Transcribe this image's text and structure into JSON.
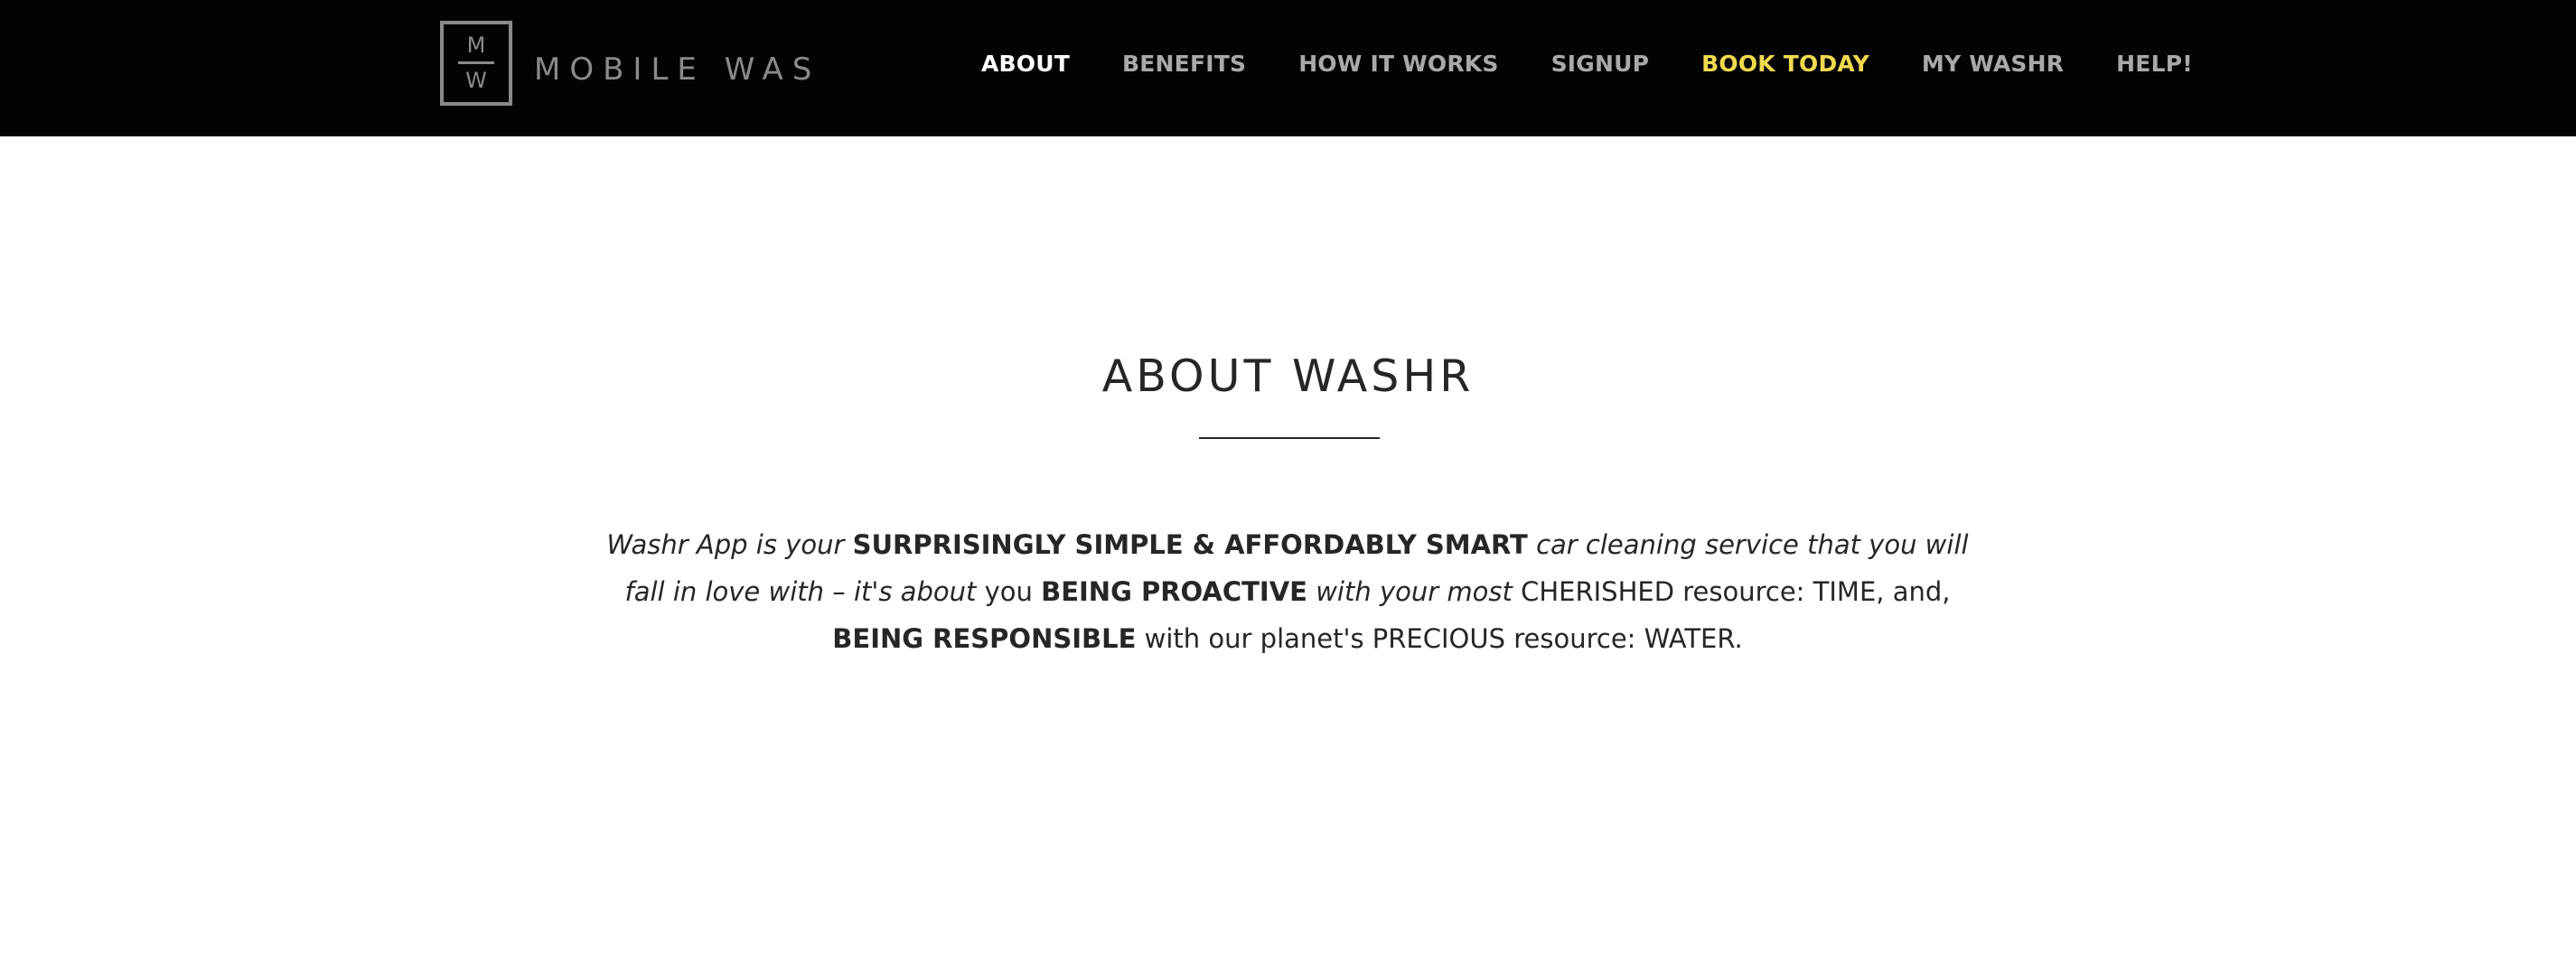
{
  "header": {
    "logo": {
      "monogram_top": "M",
      "monogram_bottom": "W",
      "wordmark": "MOBILE WAS"
    },
    "nav": [
      {
        "label": "ABOUT",
        "state": "active"
      },
      {
        "label": "BENEFITS"
      },
      {
        "label": "HOW IT WORKS"
      },
      {
        "label": "SIGNUP"
      },
      {
        "label": "BOOK TODAY",
        "state": "highlight"
      },
      {
        "label": "MY WASHR"
      },
      {
        "label": "HELP!"
      }
    ]
  },
  "main": {
    "title": "ABOUT WASHR",
    "intro": {
      "p1": "Washr App is your",
      "p2": "SURPRISINGLY SIMPLE & AFFORDABLY SMART",
      "p3": "car cleaning service that you will fall in love with – it's about",
      "p4": "you",
      "p5": "BEING PROACTIVE",
      "p6": "with your most",
      "p7": "CHERISHED resource: TIME, and,",
      "p8": "BEING RESPONSIBLE",
      "p9": "with our planet's PRECIOUS resource: WATER."
    }
  },
  "colors": {
    "header_bg": "#030303",
    "nav_default": "#a9a9a9",
    "nav_active": "#ffffff",
    "nav_highlight": "#f2d94e",
    "text": "#262626"
  }
}
